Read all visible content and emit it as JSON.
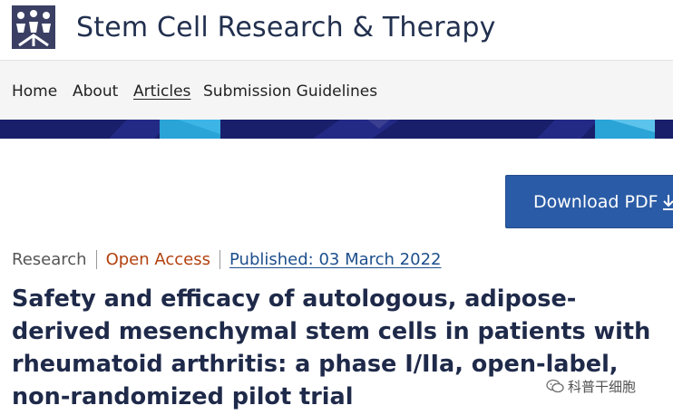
{
  "header": {
    "journal_title": "Stem Cell Research & Therapy",
    "logo_icon": "journal-logo-icon"
  },
  "nav": {
    "items": [
      {
        "label": "Home",
        "active": false
      },
      {
        "label": "About",
        "active": false
      },
      {
        "label": "Articles",
        "active": true
      },
      {
        "label": "Submission Guidelines",
        "active": false
      }
    ]
  },
  "toolbar": {
    "download_label": "Download PDF",
    "download_icon": "download-icon"
  },
  "article": {
    "type": "Research",
    "access": "Open Access",
    "published": "Published: 03 March 2022",
    "title": "Safety and efficacy of autologous, adipose-derived mesenchymal stem cells in patients with rheumatoid arthritis: a phase I/IIa, open-label, non-randomized pilot trial"
  },
  "watermark": {
    "text": "科普干细胞",
    "icon": "wechat-icon"
  },
  "colors": {
    "brand_navy": "#22304f",
    "banner_navy": "#1a1f6b",
    "banner_cyan": "#2aa3d6",
    "download_blue": "#2a5ba6",
    "open_access": "#b3410f",
    "link_blue": "#1d4f8c"
  }
}
